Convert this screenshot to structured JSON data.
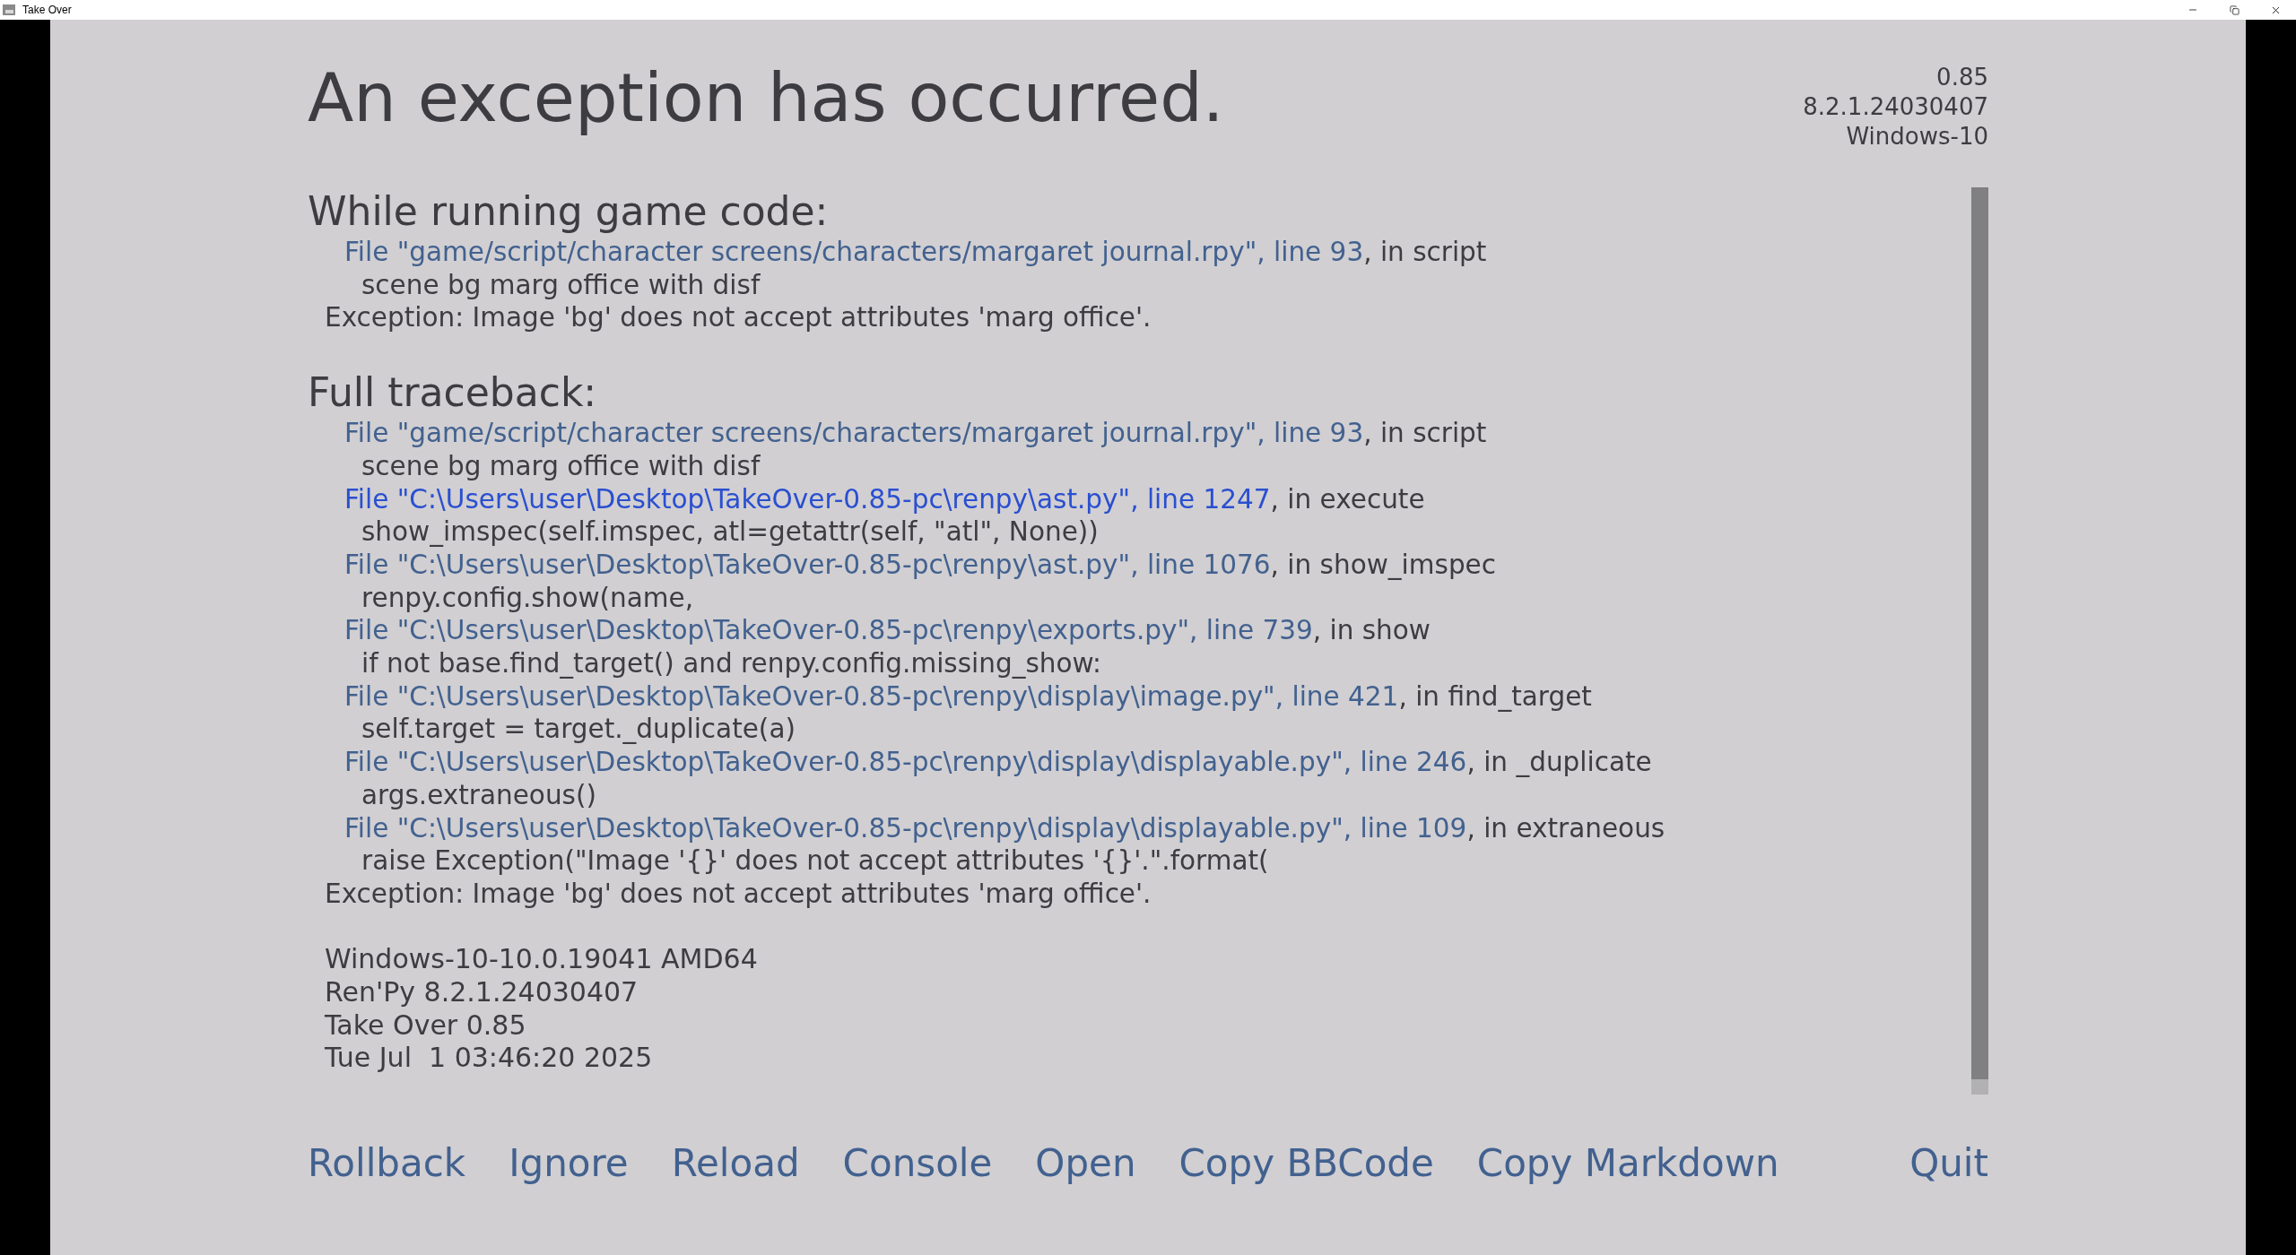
{
  "window": {
    "title": "Take Over"
  },
  "header": {
    "title": "An exception has occurred.",
    "version_info": [
      "0.85",
      "8.2.1.24030407",
      "Windows-10"
    ]
  },
  "short_traceback": {
    "heading": "While running game code:",
    "lines": [
      {
        "kind": "file",
        "link": "File \"game/script/character screens/characters/margaret journal.rpy\", line 93",
        "rest": ", in script",
        "highlighted": false
      },
      {
        "kind": "code",
        "text": "scene bg marg office with disf"
      },
      {
        "kind": "exception",
        "text": "Exception: Image 'bg' does not accept attributes 'marg office'."
      }
    ]
  },
  "full_traceback": {
    "heading": "Full traceback:",
    "lines": [
      {
        "kind": "file",
        "link": "File \"game/script/character screens/characters/margaret journal.rpy\", line 93",
        "rest": ", in script",
        "highlighted": false
      },
      {
        "kind": "code",
        "text": "scene bg marg office with disf"
      },
      {
        "kind": "file",
        "link": "File \"C:\\Users\\user\\Desktop\\TakeOver-0.85-pc\\renpy\\ast.py\", line 1247",
        "rest": ", in execute",
        "highlighted": true
      },
      {
        "kind": "code",
        "text": "show_imspec(self.imspec, atl=getattr(self, \"atl\", None))"
      },
      {
        "kind": "file",
        "link": "File \"C:\\Users\\user\\Desktop\\TakeOver-0.85-pc\\renpy\\ast.py\", line 1076",
        "rest": ", in show_imspec",
        "highlighted": false
      },
      {
        "kind": "code",
        "text": "renpy.config.show(name,"
      },
      {
        "kind": "file",
        "link": "File \"C:\\Users\\user\\Desktop\\TakeOver-0.85-pc\\renpy\\exports.py\", line 739",
        "rest": ", in show",
        "highlighted": false
      },
      {
        "kind": "code",
        "text": "if not base.find_target() and renpy.config.missing_show:"
      },
      {
        "kind": "file",
        "link": "File \"C:\\Users\\user\\Desktop\\TakeOver-0.85-pc\\renpy\\display\\image.py\", line 421",
        "rest": ", in find_target",
        "highlighted": false
      },
      {
        "kind": "code",
        "text": "self.target = target._duplicate(a)"
      },
      {
        "kind": "file",
        "link": "File \"C:\\Users\\user\\Desktop\\TakeOver-0.85-pc\\renpy\\display\\displayable.py\", line 246",
        "rest": ", in _duplicate",
        "highlighted": false
      },
      {
        "kind": "code",
        "text": "args.extraneous()"
      },
      {
        "kind": "file",
        "link": "File \"C:\\Users\\user\\Desktop\\TakeOver-0.85-pc\\renpy\\display\\displayable.py\", line 109",
        "rest": ", in extraneous",
        "highlighted": false
      },
      {
        "kind": "code",
        "text": "raise Exception(\"Image '{}' does not accept attributes '{}'.\".format("
      },
      {
        "kind": "exception",
        "text": "Exception: Image 'bg' does not accept attributes 'marg office'."
      }
    ]
  },
  "system_info": [
    "Windows-10-10.0.19041 AMD64",
    "Ren'Py 8.2.1.24030407",
    "Take Over 0.85",
    "Tue Jul  1 03:46:20 2025"
  ],
  "buttons": [
    "Rollback",
    "Ignore",
    "Reload",
    "Console",
    "Open",
    "Copy BBCode",
    "Copy Markdown"
  ],
  "quit_button": "Quit"
}
